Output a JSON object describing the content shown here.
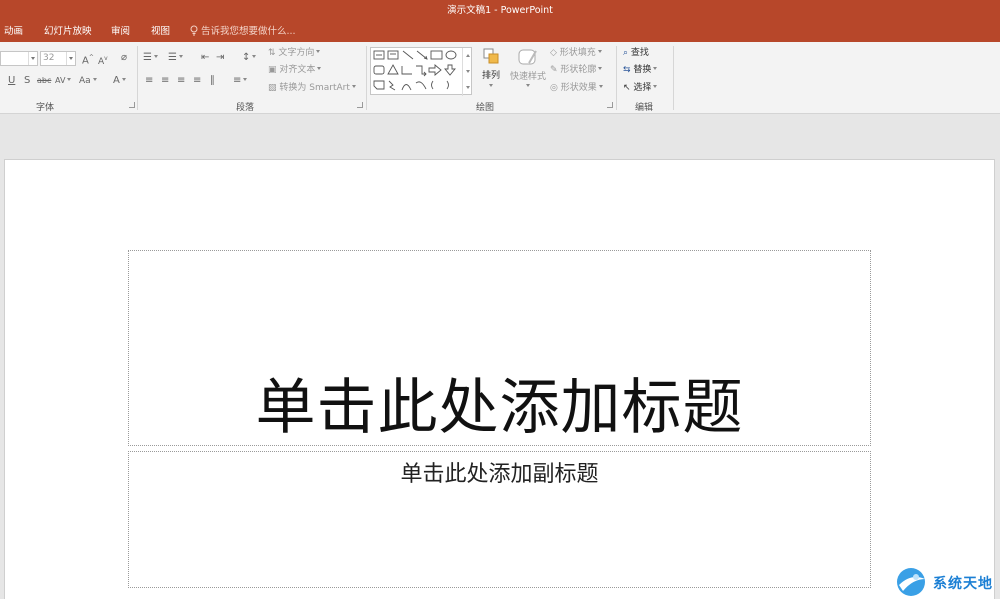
{
  "window": {
    "title": "演示文稿1 - PowerPoint"
  },
  "tabs": [
    "动画",
    "幻灯片放映",
    "审阅",
    "视图"
  ],
  "tell_me": {
    "placeholder": "告诉我您想要做什么..."
  },
  "ribbon": {
    "font": {
      "label": "字体",
      "size_value": "32"
    },
    "paragraph": {
      "label": "段落",
      "text_direction": "文字方向",
      "align_text": "对齐文本",
      "convert_smartart": "转换为 SmartArt"
    },
    "drawing": {
      "label": "绘图",
      "arrange": "排列",
      "quick_styles": "快速样式",
      "shape_fill": "形状填充",
      "shape_outline": "形状轮廓",
      "shape_effects": "形状效果"
    },
    "editing": {
      "label": "编辑",
      "find": "查找",
      "replace": "替换",
      "select": "选择"
    }
  },
  "slide": {
    "title_placeholder": "单击此处添加标题",
    "subtitle_placeholder": "单击此处添加副标题"
  },
  "watermark": {
    "text": "系统天地"
  },
  "colors": {
    "accent": "#b7472a",
    "ribbon": "#f3f3f3",
    "workspace": "#e6e6e6"
  }
}
